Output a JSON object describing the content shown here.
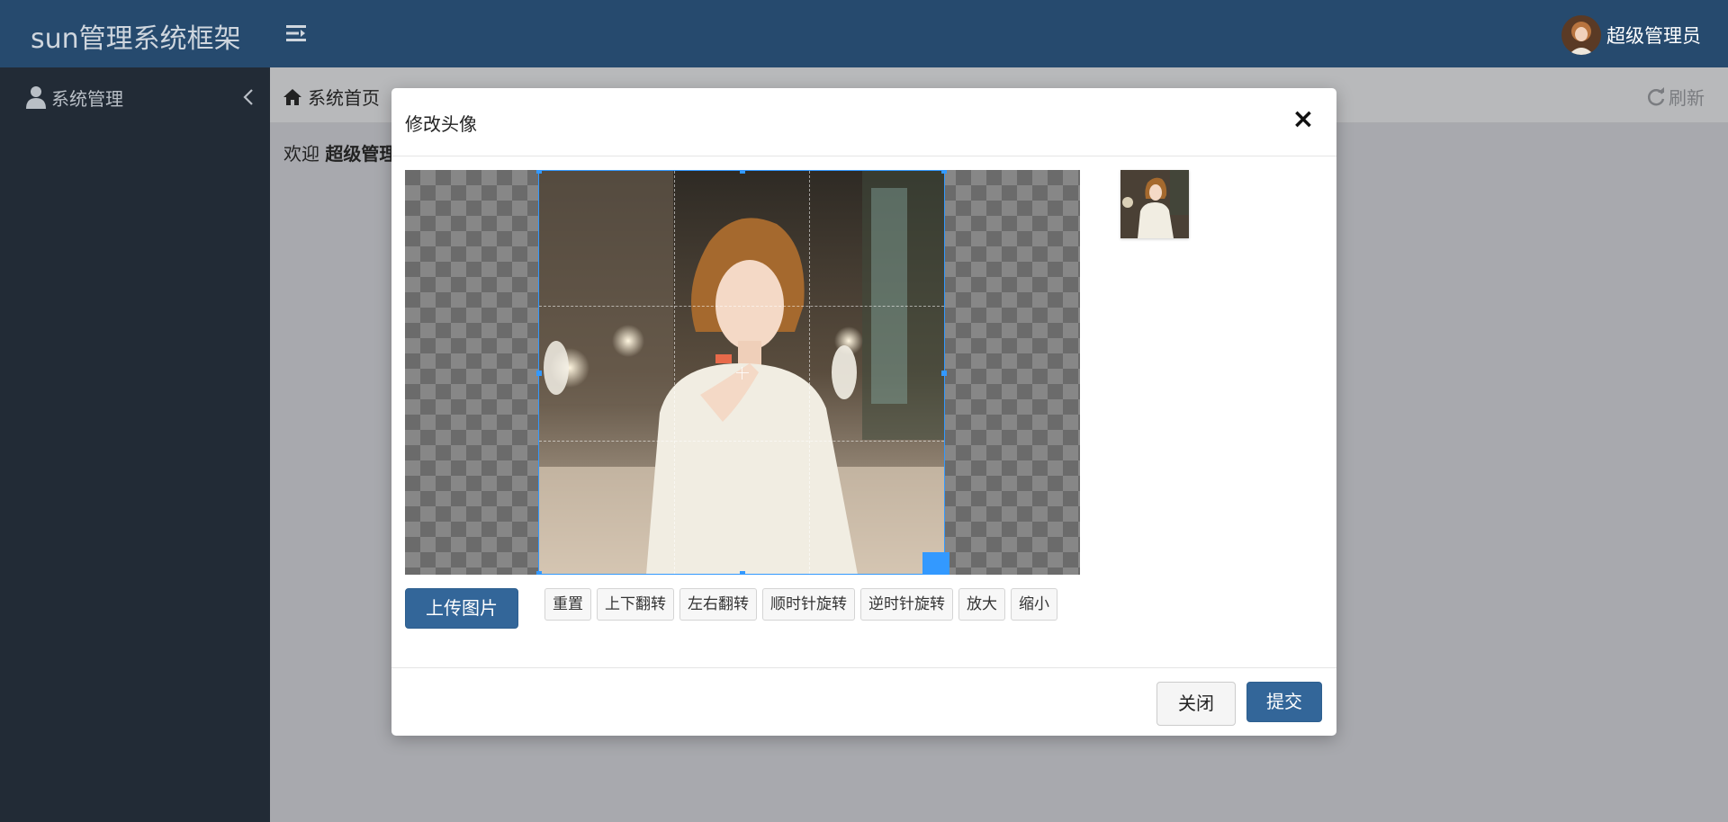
{
  "app": {
    "brand": "sun管理系统框架"
  },
  "header": {
    "user_name": "超级管理员"
  },
  "sidebar": {
    "items": [
      {
        "label": "系统管理"
      }
    ]
  },
  "tabs": {
    "home_label": "系统首页",
    "refresh_label": "刷新"
  },
  "content": {
    "welcome_prefix": "欢迎 ",
    "welcome_user": "超级管理"
  },
  "modal": {
    "title": "修改头像",
    "close_symbol": "×",
    "upload_label": "上传图片",
    "tools": [
      "重置",
      "上下翻转",
      "左右翻转",
      "顺时针旋转",
      "逆时针旋转",
      "放大",
      "缩小"
    ],
    "cancel_label": "关闭",
    "submit_label": "提交"
  },
  "colors": {
    "topbar": "#264a6e",
    "sidebar": "#222b36",
    "primary": "#336699",
    "crop_accent": "#3399ff"
  },
  "icons": [
    "menu-toggle-icon",
    "user-icon",
    "chevron-left-icon",
    "home-icon",
    "refresh-icon",
    "close-icon"
  ]
}
